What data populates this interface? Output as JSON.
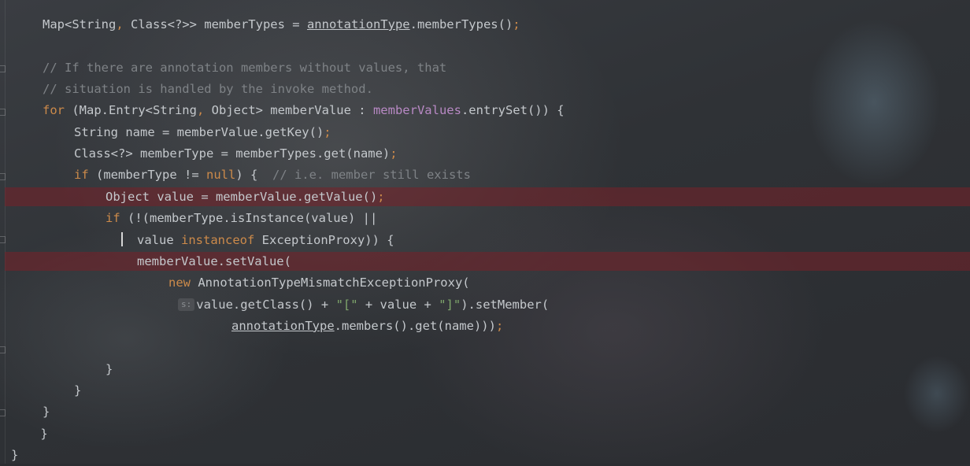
{
  "editor": {
    "language": "java",
    "lines": [
      {
        "indent": 4,
        "segments": [
          {
            "t": "Map<String"
          },
          {
            "t": ", ",
            "c": "kw"
          },
          {
            "t": "Class<?>> memberTypes = "
          },
          {
            "t": "annotationType",
            "c": "ul"
          },
          {
            "t": ".memberTypes()"
          },
          {
            "t": ";",
            "c": "kw"
          }
        ]
      },
      {
        "indent": 0,
        "segments": []
      },
      {
        "indent": 4,
        "segments": [
          {
            "t": "// If there are annotation members without values, that",
            "c": "cm"
          }
        ]
      },
      {
        "indent": 4,
        "segments": [
          {
            "t": "// situation is handled by the invoke method.",
            "c": "cm"
          }
        ]
      },
      {
        "indent": 4,
        "segments": [
          {
            "t": "for",
            "c": "kw"
          },
          {
            "t": " (Map.Entry<String"
          },
          {
            "t": ", ",
            "c": "kw"
          },
          {
            "t": "Object> memberValue : "
          },
          {
            "t": "memberValues",
            "c": "fld"
          },
          {
            "t": ".entrySet()) {"
          }
        ]
      },
      {
        "indent": 8,
        "segments": [
          {
            "t": "String name = memberValue.getKey()"
          },
          {
            "t": ";",
            "c": "kw"
          }
        ]
      },
      {
        "indent": 8,
        "segments": [
          {
            "t": "Class<?> memberType = memberTypes.get(name)"
          },
          {
            "t": ";",
            "c": "kw"
          }
        ]
      },
      {
        "indent": 8,
        "segments": [
          {
            "t": "if",
            "c": "kw"
          },
          {
            "t": " (memberType != "
          },
          {
            "t": "null",
            "c": "kw"
          },
          {
            "t": ") {  "
          },
          {
            "t": "// i.e. member still exists",
            "c": "cm"
          }
        ]
      },
      {
        "indent": 12,
        "highlight": true,
        "segments": [
          {
            "t": "Object value = memberValue.getValue()"
          },
          {
            "t": ";",
            "c": "kw"
          }
        ]
      },
      {
        "indent": 12,
        "segments": [
          {
            "t": "if",
            "c": "kw"
          },
          {
            "t": " (!(memberType.isInstance(value) ||"
          }
        ]
      },
      {
        "indent": 16,
        "caret": true,
        "segments": [
          {
            "t": "value "
          },
          {
            "t": "instanceof",
            "c": "kw"
          },
          {
            "t": " ExceptionProxy)) {"
          }
        ]
      },
      {
        "indent": 16,
        "highlight": true,
        "segments": [
          {
            "t": "memberValue.setValue("
          }
        ]
      },
      {
        "indent": 20,
        "segments": [
          {
            "t": "new",
            "c": "kw"
          },
          {
            "t": " AnnotationTypeMismatchExceptionProxy("
          }
        ]
      },
      {
        "indent": 24,
        "hint": "s:",
        "segments": [
          {
            "t": "value.getClass() + "
          },
          {
            "t": "\"[\"",
            "c": "str"
          },
          {
            "t": " + value + "
          },
          {
            "t": "\"]\"",
            "c": "str"
          },
          {
            "t": ").setMember("
          }
        ]
      },
      {
        "indent": 28,
        "segments": [
          {
            "t": "annotationType",
            "c": "ul"
          },
          {
            "t": ".members().get(name)))"
          },
          {
            "t": ";",
            "c": "kw"
          }
        ]
      },
      {
        "indent": 0,
        "segments": []
      },
      {
        "indent": 12,
        "segments": [
          {
            "t": "}"
          }
        ]
      },
      {
        "indent": 8,
        "segments": [
          {
            "t": "}"
          }
        ]
      },
      {
        "indent": 4,
        "segments": [
          {
            "t": "}"
          }
        ]
      },
      {
        "indent": 0,
        "segments": [
          {
            "t": "    }"
          }
        ]
      },
      {
        "indent": 0,
        "segments": [
          {
            "t": "}"
          }
        ]
      }
    ]
  },
  "colors": {
    "keyword": "#cc8a4a",
    "comment": "#7e8286",
    "field": "#b889c4",
    "string": "#7fa66b",
    "text": "#c4c8cc",
    "breakpoint_line": "#782028"
  }
}
